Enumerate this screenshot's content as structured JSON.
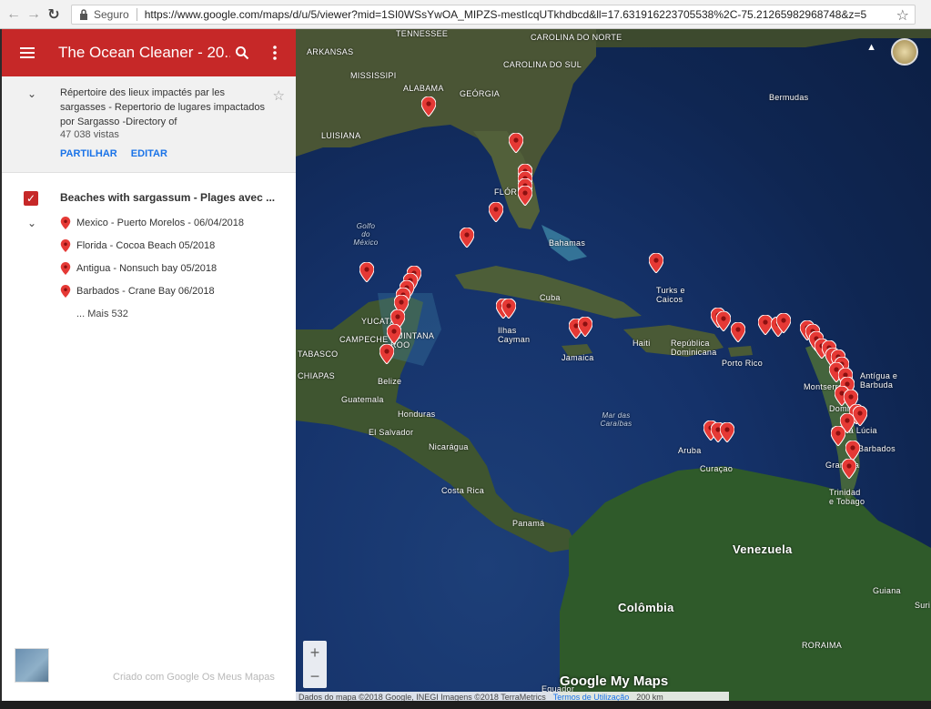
{
  "browser": {
    "secure_label": "Seguro",
    "url": "https://www.google.com/maps/d/u/5/viewer?mid=1SI0WSsYwOA_MIPZS-mestIcqUTkhdbcd&ll=17.631916223705538%2C-75.21265982968748&z=5"
  },
  "panel": {
    "title": "The Ocean Cleaner - 20...",
    "description": "Répertoire des lieux impactés par les sargasses - Repertorio de lugares impactados por Sargasso -Directory of",
    "views": "47 038 vistas",
    "share_label": "PARTILHAR",
    "edit_label": "EDITAR",
    "layer": {
      "title": "Beaches with sargassum - Plages avec ...",
      "items": [
        {
          "label": "Mexico - Puerto Morelos - 06/04/2018"
        },
        {
          "label": "Florida - Cocoa Beach 05/2018"
        },
        {
          "label": "Antigua - Nonsuch bay 05/2018"
        },
        {
          "label": "Barbados - Crane Bay 06/2018"
        }
      ],
      "more": "... Mais 532"
    },
    "credit": "Criado com Google Os Meus Mapas"
  },
  "map": {
    "labels": {
      "tennessee": "TENNESSEE",
      "carolina_norte": "CAROLINA DO NORTE",
      "arkansas": "ARKANSAS",
      "carolina_sul": "CAROLINA DO SUL",
      "mississipi": "MISSISSIPI",
      "alabama": "ALABAMA",
      "georgia": "GEÓRGIA",
      "bermudas": "Bermudas",
      "luisiana": "LUISIANA",
      "florida": "FLÓRIDA",
      "golfo": "Golfo do México",
      "bahamas": "Bahamas",
      "turks": "Turks e Caicos",
      "cuba": "Cuba",
      "yucatan": "YUCATÁN",
      "campeche": "CAMPECHE",
      "quintana": "QUINTANA ROO",
      "tabasco": "TABASCO",
      "cayman": "Ilhas Cayman",
      "haiti": "Haiti",
      "dominicana": "República Dominicana",
      "porto_rico": "Porto Rico",
      "chiapas": "CHIAPAS",
      "belize": "Belize",
      "jamaica": "Jamaica",
      "guatemala": "Guatemala",
      "antigua": "Antígua e Barbuda",
      "montserrat": "Montserrat",
      "honduras": "Honduras",
      "mar_caraibas": "Mar das Caraíbas",
      "dominica": "Dominica",
      "el_salvador": "El Salvador",
      "nicaragua": "Nicarágua",
      "santa_lucia": "Santa Lúcia",
      "barbados": "Barbados",
      "aruba": "Aruba",
      "curacao": "Curaçao",
      "granada": "Granada",
      "costa_rica": "Costa Rica",
      "trinidad": "Trinidad e Tobago",
      "panama": "Panamá",
      "venezuela": "Venezuela",
      "colombia": "Colômbia",
      "guiana": "Guiana",
      "suriname": "Suri",
      "roraima": "RORAIMA",
      "equador": "Equador"
    },
    "logo": "Google My Maps",
    "attribution": "Dados do mapa ©2018 Google, INEGI Imagens ©2018 TerraMetrics",
    "terms": "Termos de Utilização",
    "scale": "200 km",
    "zoom_in": "+",
    "zoom_out": "−"
  },
  "colors": {
    "header": "#c62828",
    "pin": "#e53935",
    "link": "#1a73e8"
  }
}
